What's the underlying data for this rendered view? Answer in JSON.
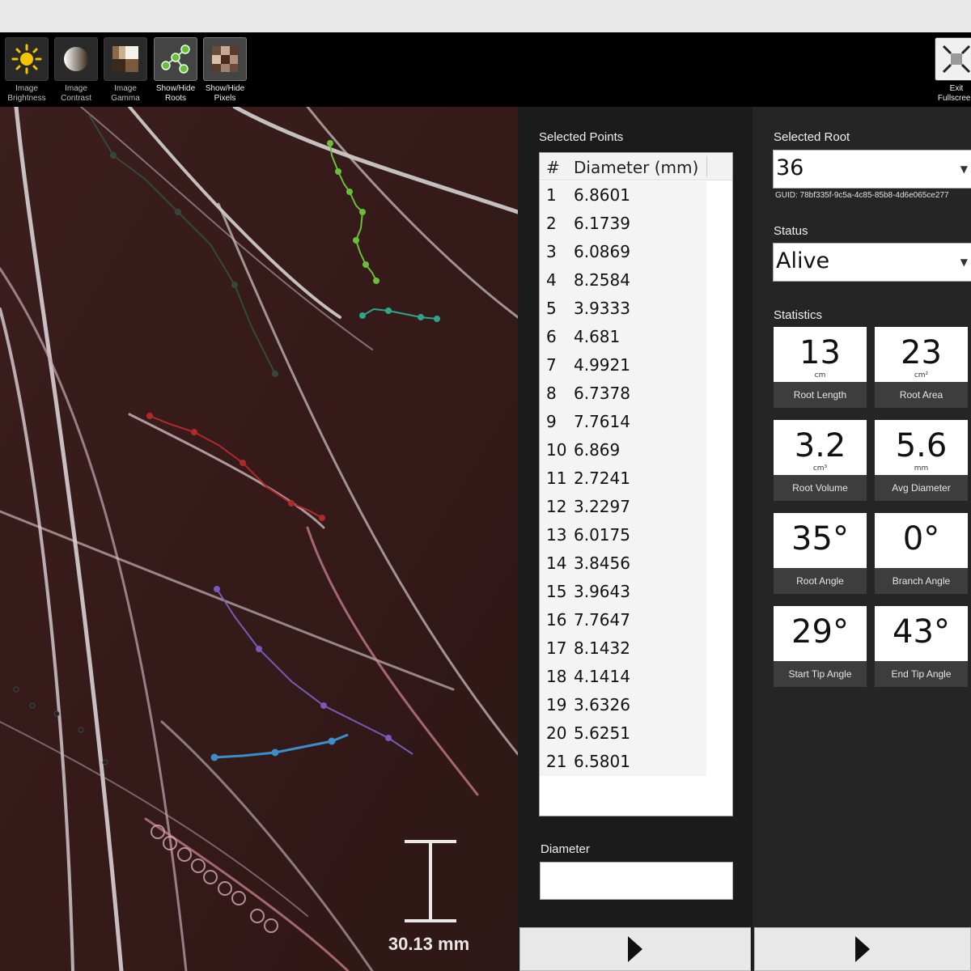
{
  "toolbar": {
    "tools": [
      {
        "line1": "Image",
        "line2": "Brightness",
        "icon": "sun-icon"
      },
      {
        "line1": "Image",
        "line2": "Contrast",
        "icon": "contrast-icon"
      },
      {
        "line1": "Image",
        "line2": "Gamma",
        "icon": "gamma-icon"
      },
      {
        "line1": "Show/Hide",
        "line2": "Roots",
        "icon": "roots-icon"
      },
      {
        "line1": "Show/Hide",
        "line2": "Pixels",
        "icon": "pixels-icon"
      }
    ],
    "exit": {
      "line1": "Exit",
      "line2": "Fullscreen",
      "icon": "exit-fullscreen-icon"
    }
  },
  "canvas": {
    "scale_label": "30.13 mm"
  },
  "points_panel": {
    "title": "Selected Points",
    "col_num": "#",
    "col_diameter": "Diameter (mm)",
    "rows": [
      {
        "n": "1",
        "d": "6.8601"
      },
      {
        "n": "2",
        "d": "6.1739"
      },
      {
        "n": "3",
        "d": "6.0869"
      },
      {
        "n": "4",
        "d": "8.2584"
      },
      {
        "n": "5",
        "d": "3.9333"
      },
      {
        "n": "6",
        "d": "4.681"
      },
      {
        "n": "7",
        "d": "4.9921"
      },
      {
        "n": "8",
        "d": "6.7378"
      },
      {
        "n": "9",
        "d": "7.7614"
      },
      {
        "n": "10",
        "d": "6.869"
      },
      {
        "n": "11",
        "d": "2.7241"
      },
      {
        "n": "12",
        "d": "3.2297"
      },
      {
        "n": "13",
        "d": "6.0175"
      },
      {
        "n": "14",
        "d": "3.8456"
      },
      {
        "n": "15",
        "d": "3.9643"
      },
      {
        "n": "16",
        "d": "7.7647"
      },
      {
        "n": "17",
        "d": "8.1432"
      },
      {
        "n": "18",
        "d": "4.1414"
      },
      {
        "n": "19",
        "d": "3.6326"
      },
      {
        "n": "20",
        "d": "5.6251"
      },
      {
        "n": "21",
        "d": "6.5801"
      }
    ],
    "diameter_label": "Diameter",
    "diameter_value": ""
  },
  "root_panel": {
    "selected_root_label": "Selected Root",
    "selected_root_value": "36",
    "guid": "GUID: 78bf335f-9c5a-4c85-85b8-4d6e065ce277",
    "status_label": "Status",
    "status_value": "Alive",
    "statistics_label": "Statistics",
    "stats": [
      {
        "value": "13",
        "unit": "cm",
        "label": "Root Length"
      },
      {
        "value": "23",
        "unit": "cm²",
        "label": "Root Area"
      },
      {
        "value": "3.2",
        "unit": "cm³",
        "label": "Root Volume"
      },
      {
        "value": "5.6",
        "unit": "mm",
        "label": "Avg Diameter"
      },
      {
        "value": "35°",
        "unit": "",
        "label": "Root Angle"
      },
      {
        "value": "0°",
        "unit": "",
        "label": "Branch Angle"
      },
      {
        "value": "29°",
        "unit": "",
        "label": "Start Tip Angle"
      },
      {
        "value": "43°",
        "unit": "",
        "label": "End Tip Angle"
      }
    ]
  },
  "colors": {
    "canvas_bg": "#3a1d1c",
    "root_white": "#d8d2d6",
    "trace_green": "#6abf3a",
    "trace_teal": "#2fa58a",
    "trace_red": "#b02a2a",
    "trace_purple": "#7a5ab8",
    "trace_blue": "#3a8fc8",
    "trace_pink": "#d28a9a"
  }
}
